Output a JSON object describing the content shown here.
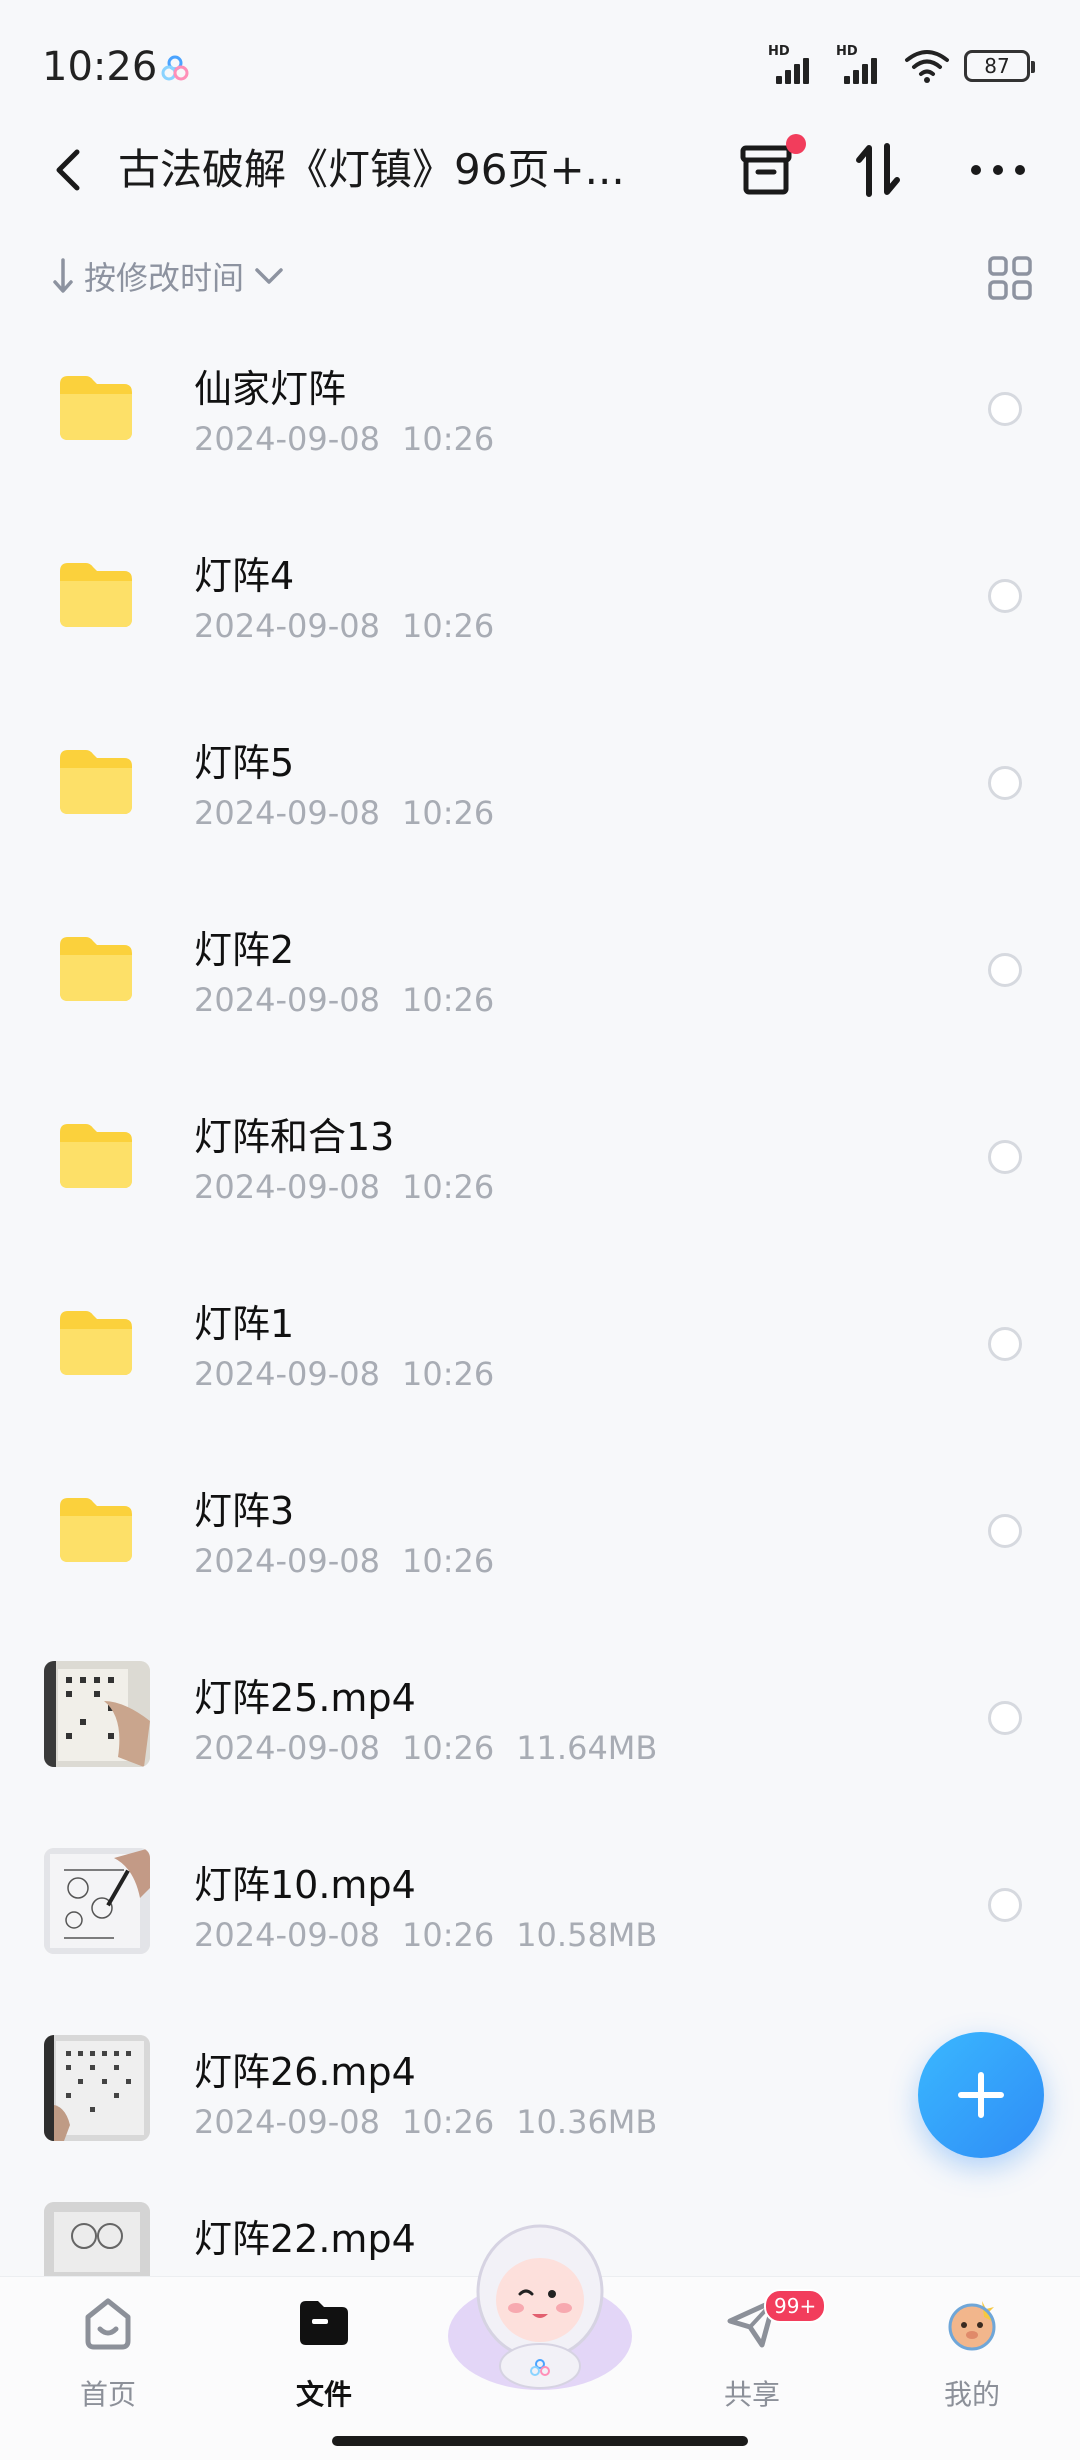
{
  "status_bar": {
    "time": "10:26",
    "signal1_label": "HD",
    "signal2_label": "HD",
    "battery": "87"
  },
  "header": {
    "title": "古法破解《灯镇》96页+..."
  },
  "sort": {
    "label": "按修改时间"
  },
  "files": [
    {
      "type": "folder",
      "name": "仙家灯阵",
      "date": "2024-09-08",
      "time": "10:26",
      "size": ""
    },
    {
      "type": "folder",
      "name": "灯阵4",
      "date": "2024-09-08",
      "time": "10:26",
      "size": ""
    },
    {
      "type": "folder",
      "name": "灯阵5",
      "date": "2024-09-08",
      "time": "10:26",
      "size": ""
    },
    {
      "type": "folder",
      "name": "灯阵2",
      "date": "2024-09-08",
      "time": "10:26",
      "size": ""
    },
    {
      "type": "folder",
      "name": "灯阵和合13",
      "date": "2024-09-08",
      "time": "10:26",
      "size": ""
    },
    {
      "type": "folder",
      "name": "灯阵1",
      "date": "2024-09-08",
      "time": "10:26",
      "size": ""
    },
    {
      "type": "folder",
      "name": "灯阵3",
      "date": "2024-09-08",
      "time": "10:26",
      "size": ""
    },
    {
      "type": "video",
      "name": "灯阵25.mp4",
      "date": "2024-09-08",
      "time": "10:26",
      "size": "11.64MB"
    },
    {
      "type": "video",
      "name": "灯阵10.mp4",
      "date": "2024-09-08",
      "time": "10:26",
      "size": "10.58MB"
    },
    {
      "type": "video",
      "name": "灯阵26.mp4",
      "date": "2024-09-08",
      "time": "10:26",
      "size": "10.36MB"
    },
    {
      "type": "video",
      "name": "灯阵22.mp4",
      "date": "",
      "time": "",
      "size": ""
    }
  ],
  "bottom_nav": {
    "home": "首页",
    "files": "文件",
    "share": "共享",
    "share_badge": "99+",
    "me": "我的"
  },
  "colors": {
    "accent": "#2f8cf6",
    "folder": "#fcd34d",
    "badge": "#f23d5c"
  }
}
